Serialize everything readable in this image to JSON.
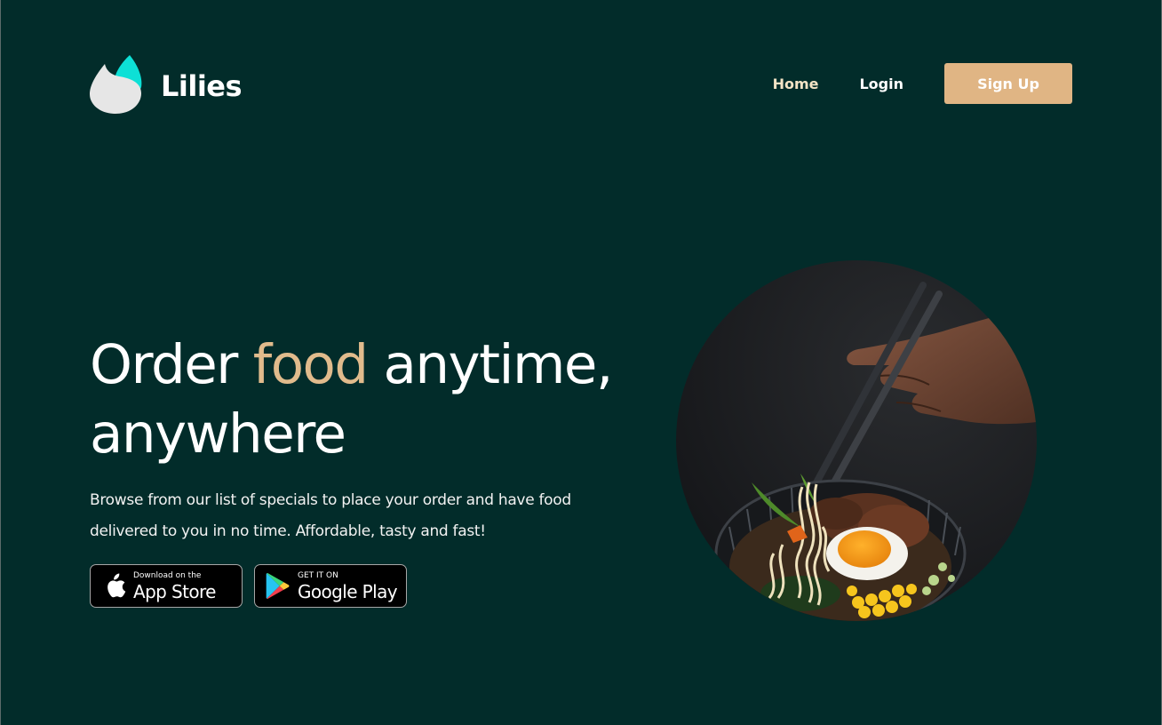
{
  "header": {
    "brand": "Lilies",
    "nav": {
      "home": "Home",
      "login": "Login",
      "signup": "Sign Up"
    }
  },
  "hero": {
    "title_part1": "Order ",
    "title_accent": "food",
    "title_part2": " anytime,",
    "title_line2": "anywhere",
    "description_line1": "Browse from our list of specials to place your order and have food",
    "description_line2": "delivered to you in no time. Affordable, tasty and fast!"
  },
  "badges": {
    "app_store": {
      "small": "Download on the",
      "big": "App Store"
    },
    "google_play": {
      "small": "GET IT ON",
      "big": "Google Play"
    }
  },
  "icons": {
    "logo": "leaf-drop-logo",
    "apple": "apple-icon",
    "play": "google-play-icon",
    "food": "ramen-bowl-image"
  },
  "colors": {
    "background": "#022c2a",
    "accent": "#e1bb8c",
    "signup_bg": "#e0b584",
    "logo_teal": "#0de0d6"
  }
}
